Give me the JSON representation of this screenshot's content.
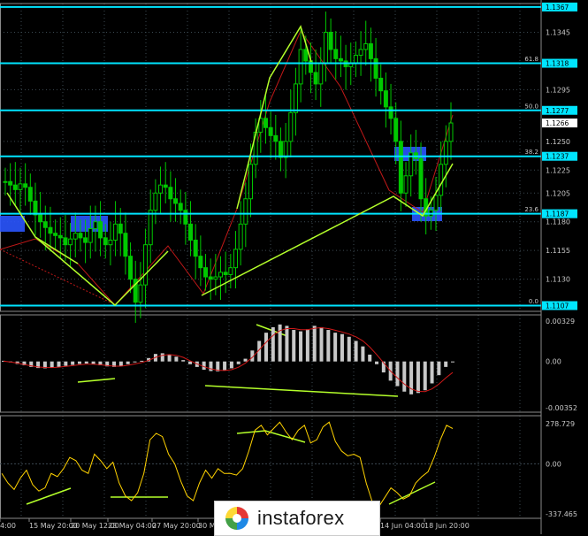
{
  "chart_data": {
    "type": "candlestick",
    "colors": {
      "background": "#000000",
      "candles": "#00c800",
      "fib_lines": "#00e5ff",
      "trend_lines": "#b4ff2a",
      "zigzag": "#c01818",
      "fib_blocks": "#2a55ff",
      "macd_hist": "#c8c8c8",
      "macd_signal": "#d01818",
      "stoch": "#ffd200",
      "grid": "#3c4a52"
    },
    "price_axis": {
      "ticks": [
        "1.1367",
        "1.1345",
        "1.1318",
        "1.1295",
        "1.1277",
        "1.1266",
        "1.1250",
        "1.1237",
        "1.1225",
        "1.1205",
        "1.1187",
        "1.1180",
        "1.1155",
        "1.1130",
        "1.1107"
      ],
      "range": [
        1.1102,
        1.137
      ]
    },
    "fib_levels": [
      {
        "pct": "",
        "price": "1.1367"
      },
      {
        "pct": "61.8",
        "price": "1.1318"
      },
      {
        "pct": "50.0",
        "price": "1.1277"
      },
      {
        "pct": "38.2",
        "price": "1.1237"
      },
      {
        "pct": "23.6",
        "price": "1.1187"
      },
      {
        "pct": "0.0",
        "price": "1.1107"
      }
    ],
    "current_price": "1.1266",
    "time_labels": [
      "4:00",
      "15 May 20:00",
      "20 May 12:00",
      "23 May 04:00",
      "27 May 20:00",
      "30 Ma",
      "14 Jun 04:00",
      "18 Jun 20:00"
    ],
    "macd": {
      "ticks": [
        "0.00329",
        "0.00",
        "-0.00352"
      ],
      "range": [
        -0.0037,
        0.0034
      ]
    },
    "cci": {
      "ticks": [
        "278.729",
        "0.00",
        "-337.465"
      ],
      "range": [
        -340,
        300
      ]
    },
    "closes": [
      1.1215,
      1.1212,
      1.1208,
      1.1213,
      1.121,
      1.1198,
      1.1186,
      1.118,
      1.1175,
      1.117,
      1.1168,
      1.1166,
      1.116,
      1.1165,
      1.117,
      1.1166,
      1.1162,
      1.1174,
      1.118,
      1.1166,
      1.116,
      1.1164,
      1.1178,
      1.117,
      1.115,
      1.113,
      1.111,
      1.1125,
      1.116,
      1.119,
      1.1205,
      1.1212,
      1.121,
      1.12,
      1.1196,
      1.119,
      1.1178,
      1.1164,
      1.115,
      1.114,
      1.1132,
      1.113,
      1.1132,
      1.1136,
      1.1134,
      1.114,
      1.1156,
      1.1178,
      1.12,
      1.123,
      1.1258,
      1.127,
      1.1262,
      1.1255,
      1.125,
      1.1236,
      1.125,
      1.1275,
      1.13,
      1.133,
      1.132,
      1.131,
      1.13,
      1.1318,
      1.1345,
      1.133,
      1.1322,
      1.132,
      1.1315,
      1.1318,
      1.1325,
      1.133,
      1.1335,
      1.1322,
      1.1305,
      1.1294,
      1.128,
      1.127,
      1.125,
      1.1205,
      1.122,
      1.124,
      1.1235,
      1.12,
      1.1185,
      1.119,
      1.1203,
      1.123,
      1.125,
      1.1266
    ],
    "macd_hist": [
      5e-05,
      -5e-05,
      -0.00018,
      -0.00028,
      -0.0004,
      -0.00048,
      -0.0005,
      -0.00046,
      -0.0004,
      -0.00032,
      -0.00025,
      -0.00018,
      -0.00015,
      -0.0002,
      -0.00028,
      -0.00036,
      -0.0004,
      -0.00034,
      -0.0002,
      -5e-05,
      5e-05,
      0.00025,
      0.00055,
      0.0006,
      0.0005,
      0.00035,
      0.0001,
      -0.0002,
      -0.0004,
      -0.0006,
      -0.0007,
      -0.00072,
      -0.00065,
      -0.0005,
      -0.0002,
      0.0002,
      0.0008,
      0.0015,
      0.0021,
      0.0025,
      0.0027,
      0.0026,
      0.0023,
      0.0022,
      0.00235,
      0.0026,
      0.0025,
      0.0023,
      0.0021,
      0.002,
      0.0018,
      0.0015,
      0.0011,
      0.0005,
      -0.0002,
      -0.0008,
      -0.0014,
      -0.0018,
      -0.0022,
      -0.0024,
      -0.0023,
      -0.0021,
      -0.0016,
      -0.001,
      -0.0004,
      0.0
    ],
    "macd_signal": [
      2e-05,
      -4e-05,
      -0.00012,
      -0.00022,
      -0.00032,
      -0.0004,
      -0.00044,
      -0.00045,
      -0.00042,
      -0.00036,
      -0.0003,
      -0.00024,
      -0.0002,
      -0.0002,
      -0.00024,
      -0.0003,
      -0.00034,
      -0.00034,
      -0.00028,
      -0.00018,
      -8e-05,
      8e-05,
      0.0003,
      0.00045,
      0.0005,
      0.00045,
      0.0003,
      5e-05,
      -0.00018,
      -0.00038,
      -0.00054,
      -0.00064,
      -0.00066,
      -0.0006,
      -0.00042,
      -0.00012,
      0.0003,
      0.00085,
      0.0014,
      0.0019,
      0.00225,
      0.0024,
      0.0024,
      0.00232,
      0.00232,
      0.00242,
      0.00246,
      0.0024,
      0.00228,
      0.00215,
      0.002,
      0.0018,
      0.0015,
      0.00105,
      0.0005,
      -0.0001,
      -0.0007,
      -0.0012,
      -0.00165,
      -0.002,
      -0.00218,
      -0.0022,
      -0.002,
      -0.00165,
      -0.0012,
      -0.0008
    ],
    "cci_values": [
      -60,
      -120,
      -160,
      -90,
      -40,
      -130,
      -170,
      -150,
      -60,
      -80,
      -30,
      40,
      20,
      -40,
      -60,
      60,
      20,
      -30,
      10,
      -120,
      -200,
      -230,
      -180,
      -60,
      150,
      190,
      170,
      60,
      0,
      -110,
      -200,
      -230,
      -120,
      -40,
      -90,
      -30,
      -60,
      -60,
      -70,
      -30,
      80,
      210,
      240,
      180,
      220,
      260,
      200,
      150,
      210,
      240,
      130,
      150,
      230,
      260,
      140,
      80,
      50,
      60,
      40,
      -120,
      -240,
      -270,
      -210,
      -150,
      -180,
      -220,
      -200,
      -120,
      -80,
      -50,
      40,
      150,
      240,
      220
    ]
  },
  "brand": {
    "name": "instaforex",
    "logo_colors": [
      "#e53935",
      "#1e88e5",
      "#43a047",
      "#fdd835"
    ]
  }
}
